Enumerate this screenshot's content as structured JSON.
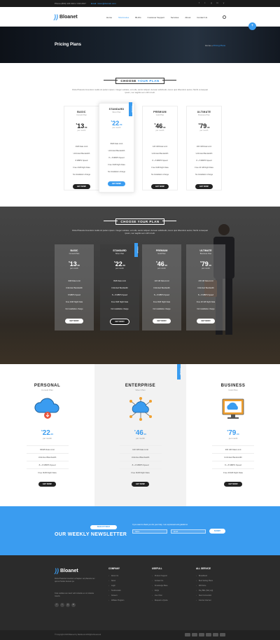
{
  "topbar": {
    "phone": "Phone:(800) 123 0101 / 240 2917",
    "email": "Email: mixer@domain.com",
    "social": [
      "f",
      "t",
      "g",
      "in",
      "y"
    ]
  },
  "header": {
    "logo": "Bloanet",
    "nav": [
      "Home",
      "Shortcodes",
      "BLOG",
      "Customer Support",
      "Services",
      "About",
      "Contact Us"
    ],
    "active_index": 1
  },
  "banner": {
    "title": "Pricing Plans",
    "crumb_home": "Home",
    "crumb_sep": "»",
    "crumb_current": "Pricing Plans"
  },
  "section1": {
    "label_pre": "CHOOSE ",
    "label_accent": "YOUR PLAN",
    "desc": "Dicta Pharetra Incendum mattis sit partem ipsum. Integer sodales, vel odio, auctor aliquet. Aenean sollicitudin, lorem quis bibendum auctor, Morbi consequat ipsum, nec sagittis sem nibh id elit."
  },
  "plans_light": [
    {
      "name": "BASIC",
      "sub": "Consult Plan",
      "currency": "$",
      "price": "13",
      "cents": ".00",
      "per": "per month",
      "features": [
        "4GB Data Limit",
        "Unlimited Bandwidth",
        "8 MBPS Speed",
        "Free 2GB Night Data",
        "No Installation charge"
      ],
      "btn": "GET NOW!"
    },
    {
      "name": "STANDARD",
      "sub": "Silver Plan",
      "currency": "$",
      "price": "22",
      "cents": ".50",
      "per": "per month",
      "features": [
        "8GB Data Limit",
        "Unlimited Bandwidth",
        "8 + 8 MBPS Speed",
        "Free 3GB Night Data",
        "No Installation charge"
      ],
      "btn": "GET NOW!",
      "ribbon": "POPULAR"
    },
    {
      "name": "PREMIUM",
      "sub": "Gold Plan",
      "currency": "$",
      "price": "46",
      "cents": ".00",
      "per": "per month",
      "features": [
        "120 GB Data Limit",
        "Unlimited Bandwidth",
        "8 + 8 MBPS Speed",
        "Free 9GB Night Data",
        "No Installation charge"
      ],
      "btn": "GET NOW!"
    },
    {
      "name": "ULTIMATE",
      "sub": "Business Plan",
      "currency": "$",
      "price": "79",
      "cents": ".00",
      "per": "per month",
      "features": [
        "200 GB Data Limit",
        "Unlimited Bandwidth",
        "8 + 8 MBPS Speed",
        "Free 20 GB Night Data",
        "No Installation charge"
      ],
      "btn": "GET NOW!"
    }
  ],
  "section2": {
    "label": "CHOOSE YOUR PLAN",
    "desc": "Dicta Pharetra Incendum mattis sit partem ipsum. Integer sodales, vel odio, auctor aliquet. Aenean sollicitudin, lorem quis bibendum auctor, Morbi consequat ipsum, nec sagittis sem nibh id elit."
  },
  "plans_dark": [
    {
      "name": "BASIC",
      "sub": "Consult Plan",
      "currency": "$",
      "price": "13",
      "cents": ".00",
      "per": "per month",
      "features": [
        "4GB Data Limit",
        "Unlimited Bandwidth",
        "8 MBPS Speed",
        "Free 2GB Night Data",
        "No Installation charge"
      ],
      "btn": "GET NOW!"
    },
    {
      "name": "STANDARD",
      "sub": "Silver Plan",
      "currency": "$",
      "price": "22",
      "cents": ".50",
      "per": "per month",
      "features": [
        "8GB Data Limit",
        "Unlimited Bandwidth",
        "8 + 8 MBPS Speed",
        "Free 3GB Night Data",
        "No Installation charge"
      ],
      "btn": "GET NOW!",
      "ribbon": "POPULAR"
    },
    {
      "name": "PREMIUM",
      "sub": "Gold Plan",
      "currency": "$",
      "price": "46",
      "cents": ".00",
      "per": "per month",
      "features": [
        "120 GB Data Limit",
        "Unlimited Bandwidth",
        "8 + 8 MBPS Speed",
        "Free 9GB Night Data",
        "No Installation charge"
      ],
      "btn": "GET NOW!"
    },
    {
      "name": "ULTIMATE",
      "sub": "Business Plan",
      "currency": "$",
      "price": "79",
      "cents": ".00",
      "per": "per month",
      "features": [
        "200 GB Data Limit",
        "Unlimited Bandwidth",
        "8 + 8 MBPS Speed",
        "Free 20 GB Night Data",
        "No Installation charge"
      ],
      "btn": "GET NOW!"
    }
  ],
  "plans_icon": [
    {
      "name": "PERSONAL",
      "sub": "Consult Plan",
      "currency": "$",
      "price": "22",
      "cents": ".00",
      "per": "per month",
      "features": [
        "80GB Data Limit",
        "Unlimited Bandwidth",
        "8 + 8 MBPS Speed",
        "Free 9GB Night Data"
      ],
      "btn": "GET NOW!"
    },
    {
      "name": "ENTERPRISE",
      "sub": "Silver Plan",
      "currency": "$",
      "price": "46",
      "cents": ".00",
      "per": "per month",
      "features": [
        "120 GB Data Limit",
        "Unlimited Bandwidth",
        "8 + 8 MBPS Speed",
        "Free 9GB Night Data"
      ],
      "btn": "GET NOW!",
      "ribbon": "POPULAR"
    },
    {
      "name": "BUSINESS",
      "sub": "Gold Plan",
      "currency": "$",
      "price": "79",
      "cents": ".00",
      "per": "per month",
      "features": [
        "200 GB Data Limit",
        "Unlimited Bandwidth",
        "8 + 8 MBPS Speed",
        "Free 30GB Night Data"
      ],
      "btn": "GET NOW!"
    }
  ],
  "newsletter": {
    "pill": "SIGN UP TODAY",
    "title": "OUR WEEKLY NEWSLETTER",
    "note": "If you want to thank you for your help, I am expressed and grateful to",
    "name_ph": "Name",
    "email_ph": "Email",
    "submit": "SUBMIT"
  },
  "footer": {
    "logo": "Bloanet",
    "about": "Dicta Pharetra Incendum at Sapien vel pharetra nec quis at Sodes Aenean pe.",
    "about2": "Cras sodales as mauri velit molestie ex ut molestie mauris.",
    "social": [
      "f",
      "t",
      "g",
      "in"
    ],
    "cols": [
      {
        "title": "COMPANY",
        "items": [
          "About Us",
          "News",
          "Login",
          "Testimonials",
          "Careers",
          "Affiliate Program"
        ]
      },
      {
        "title": "USEFULL",
        "items": [
          "Product Support",
          "Contact Us",
          "Knowledge Base",
          "FAQs",
          "Live Chat",
          "Request a Quote"
        ]
      },
      {
        "title": "ALL SERVICE",
        "items": [
          "Broadband",
          "Best Selling Plans",
          "Wifi Zone",
          "Pay Bills (NE (us))",
          "New Connection",
          "Internet Internet"
        ]
      }
    ],
    "copyright": "© Copyright 2016 Bloanet by Webdesix   All Rights Reserved",
    "payments": [
      "visa",
      "mc",
      "amex",
      "paypal",
      "disc",
      "cirrus"
    ]
  }
}
